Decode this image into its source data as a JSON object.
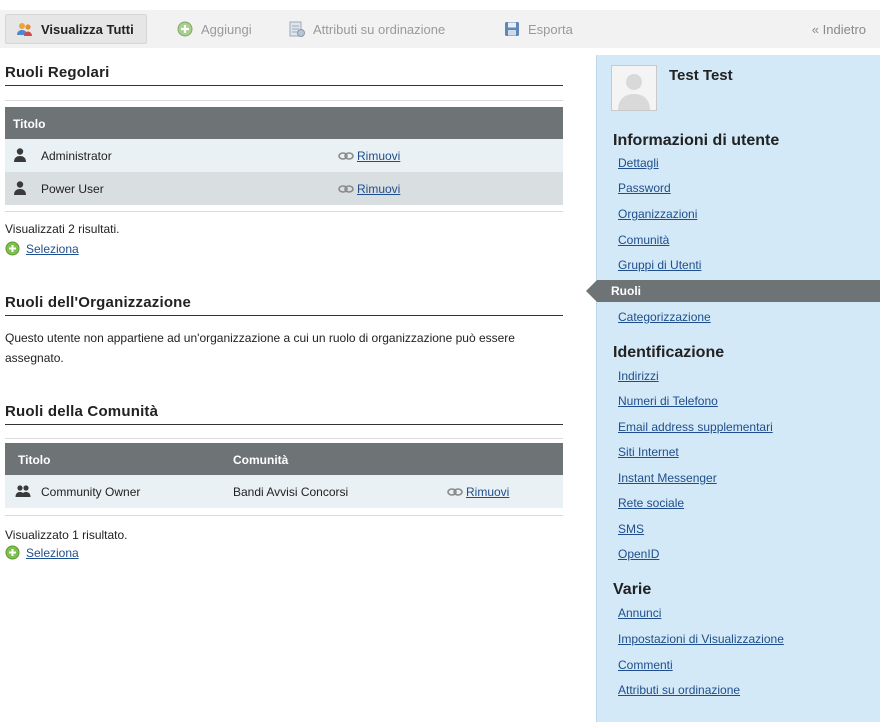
{
  "toolbar": {
    "view_all": "Visualizza Tutti",
    "add": "Aggiungi",
    "order_attributes": "Attributi su ordinazione",
    "export": "Esporta",
    "back": "« Indietro"
  },
  "regular_roles": {
    "title": "Ruoli Regolari",
    "header_title": "Titolo",
    "rows": [
      {
        "name": "Administrator",
        "action": "Rimuovi"
      },
      {
        "name": "Power User",
        "action": "Rimuovi"
      }
    ],
    "result_text": "Visualizzati 2 risultati.",
    "select": "Seleziona"
  },
  "org_roles": {
    "title": "Ruoli dell'Organizzazione",
    "message": "Questo utente non appartiene ad un'organizzazione a cui un ruolo di organizzazione può essere assegnato."
  },
  "community_roles": {
    "title": "Ruoli della Comunità",
    "header_title": "Titolo",
    "header_community": "Comunità",
    "rows": [
      {
        "name": "Community Owner",
        "community": "Bandi Avvisi Concorsi",
        "action": "Rimuovi"
      }
    ],
    "result_text": "Visualizzato 1 risultato.",
    "select": "Seleziona"
  },
  "sidebar": {
    "user_name": "Test Test",
    "sections": [
      {
        "title": "Informazioni di utente",
        "items": [
          "Dettagli",
          "Password",
          "Organizzazioni",
          "Comunità",
          "Gruppi di Utenti",
          "Ruoli",
          "Categorizzazione"
        ]
      },
      {
        "title": "Identificazione",
        "items": [
          "Indirizzi",
          "Numeri di Telefono",
          "Email address supplementari",
          "Siti Internet",
          "Instant Messenger",
          "Rete sociale",
          "SMS",
          "OpenID"
        ]
      },
      {
        "title": "Varie",
        "items": [
          "Annunci",
          "Impostazioni di Visualizzazione",
          "Commenti",
          "Attributi su ordinazione"
        ]
      }
    ],
    "active_item": "Ruoli"
  }
}
